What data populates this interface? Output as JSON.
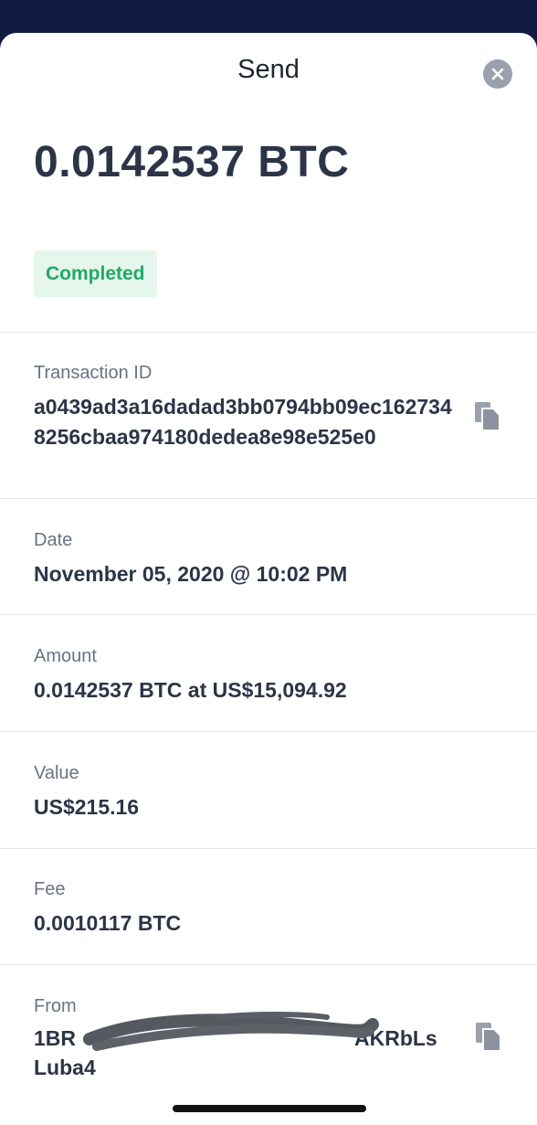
{
  "header": {
    "title": "Send"
  },
  "summary": {
    "amount": "0.0142537 BTC",
    "status": "Completed"
  },
  "details": {
    "txid": {
      "label": "Transaction ID",
      "value": "a0439ad3a16dadad3bb0794bb09ec1627348256cbaa974180dedea8e98e525e0"
    },
    "date": {
      "label": "Date",
      "value": "November 05, 2020 @ 10:02 PM"
    },
    "amount": {
      "label": "Amount",
      "value": "0.0142537 BTC at US$15,094.92"
    },
    "value": {
      "label": "Value",
      "value": "US$215.16"
    },
    "fee": {
      "label": "Fee",
      "value": "0.0010117 BTC"
    },
    "from": {
      "label": "From",
      "value_visible_start": "1BR",
      "value_visible_end": "AKRbLs",
      "value_line2": "Luba4"
    }
  },
  "colors": {
    "status_green": "#21a965",
    "status_bg": "#e5f6ec",
    "text_dark": "#2c3547",
    "text_muted": "#6a7282"
  },
  "icons": {
    "close": "close-icon",
    "copy": "copy-icon"
  }
}
